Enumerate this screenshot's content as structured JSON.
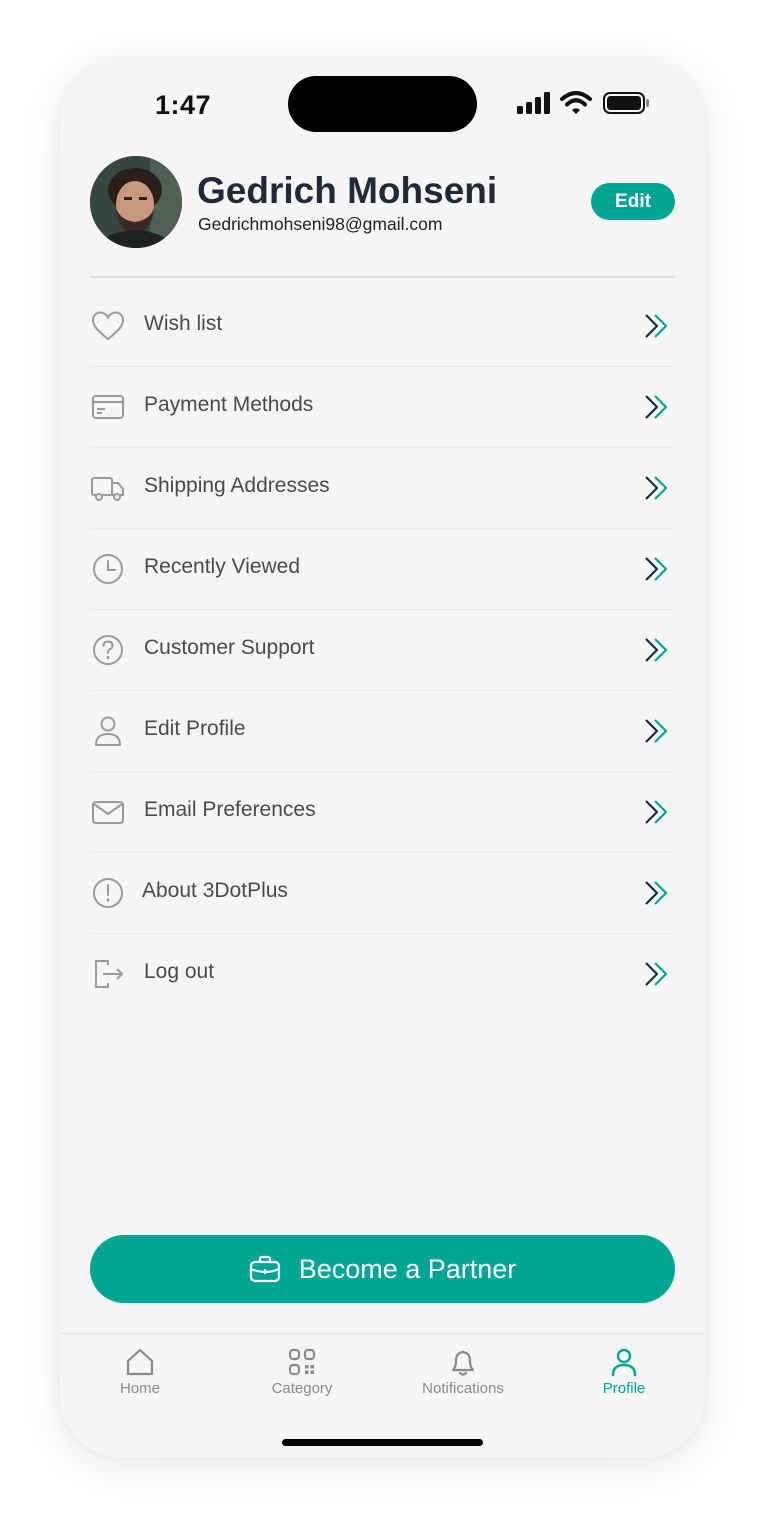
{
  "status_bar": {
    "time": "1:47"
  },
  "profile": {
    "name": "Gedrich Mohseni",
    "email": "Gedrichmohseni98@gmail.com",
    "edit_label": "Edit"
  },
  "menu": {
    "items": [
      {
        "label": "Wish list",
        "icon": "heart-icon"
      },
      {
        "label": "Payment Methods",
        "icon": "credit-card-icon"
      },
      {
        "label": "Shipping Addresses",
        "icon": "truck-icon"
      },
      {
        "label": "Recently Viewed",
        "icon": "clock-icon"
      },
      {
        "label": "Customer Support",
        "icon": "question-icon"
      },
      {
        "label": "Edit Profile",
        "icon": "user-icon"
      },
      {
        "label": "Email Preferences",
        "icon": "envelope-icon"
      },
      {
        "label": "About 3DotPlus",
        "icon": "info-icon"
      },
      {
        "label": "Log out",
        "icon": "logout-icon"
      }
    ],
    "chevron_icon": "double-chevron-right-icon"
  },
  "partner_button": {
    "label": "Become a Partner",
    "icon": "briefcase-icon"
  },
  "tab_bar": {
    "tabs": [
      {
        "label": "Home",
        "icon": "home-icon"
      },
      {
        "label": "Category",
        "icon": "category-icon"
      },
      {
        "label": "Notifications",
        "icon": "bell-icon"
      },
      {
        "label": "Profile",
        "icon": "user-icon"
      }
    ],
    "active": "Profile"
  },
  "colors": {
    "accent": "#00a693",
    "text_dark": "#1f2937",
    "text_body": "#4a4a4a",
    "icon_gray": "#9a9a9a"
  }
}
